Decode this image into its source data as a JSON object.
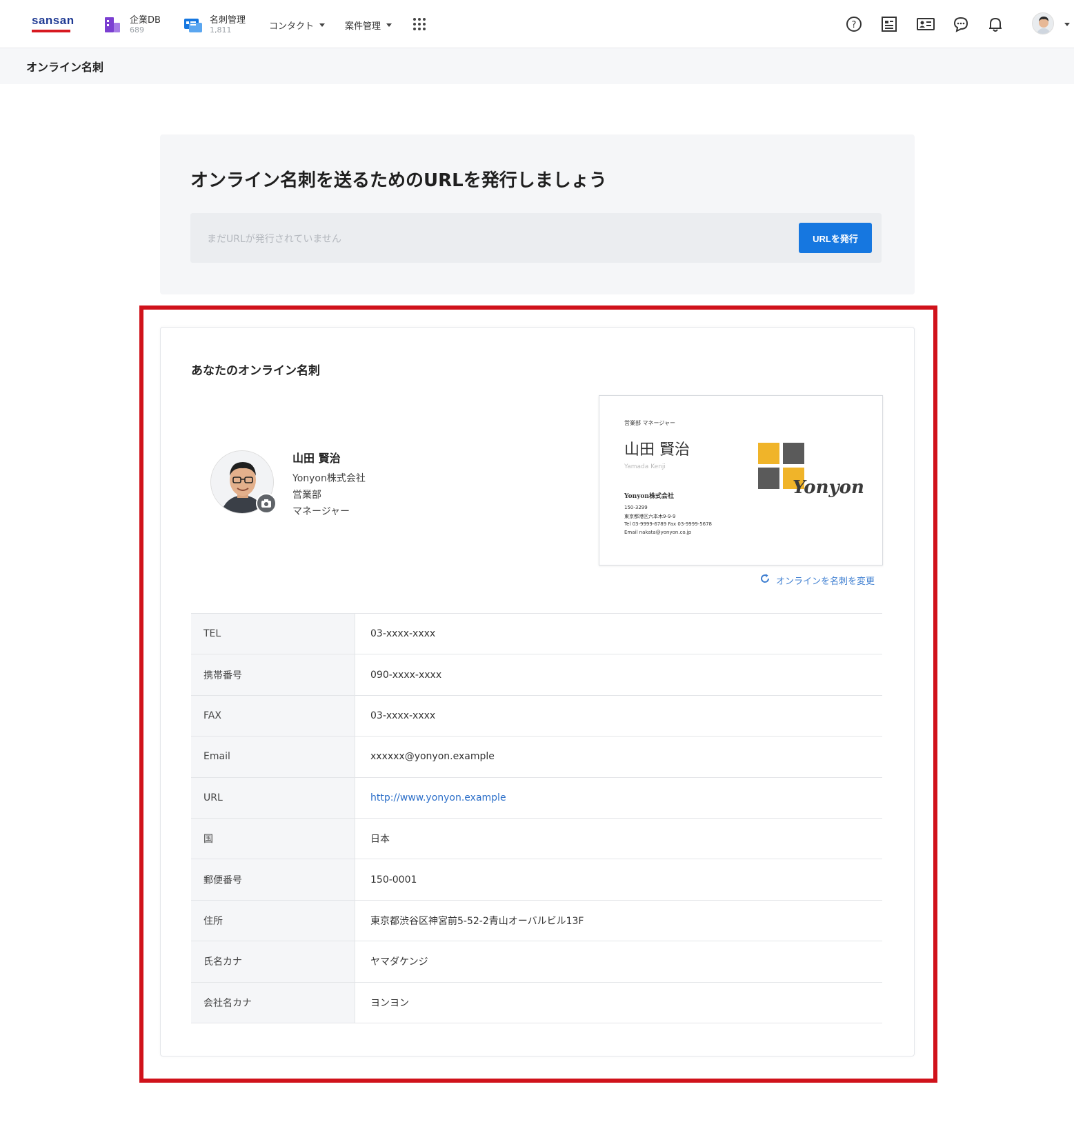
{
  "nav": {
    "logo": "sansan",
    "apps": [
      {
        "label": "企業DB",
        "count": "689"
      },
      {
        "label": "名刺管理",
        "count": "1,811"
      }
    ],
    "menus": [
      "コンタクト",
      "案件管理"
    ]
  },
  "page": {
    "title": "オンライン名刺"
  },
  "url_panel": {
    "heading": "オンライン名刺を送るためのURLを発行しましょう",
    "placeholder": "まだURLが発行されていません",
    "issue_button": "URLを発行"
  },
  "card_panel": {
    "section_title": "あなたのオンライン名刺",
    "profile": {
      "name": "山田 賢治",
      "company": "Yonyon株式会社",
      "department": "営業部",
      "title": "マネージャー"
    },
    "business_card": {
      "role": "営業部 マネージャー",
      "name": "山田 賢治",
      "roman": "Yamada Kenji",
      "company": "Yonyon株式会社",
      "postal": "150-3299",
      "address": "東京都港区六本木9-9-9",
      "tel_fax": "Tel 03-9999-6789  Fax 03-9999-5678",
      "email": "Email nakata@yonyon.co.jp",
      "brand": "Yonyon"
    },
    "change_link": "オンラインを名刺を変更",
    "fields": [
      {
        "label": "TEL",
        "value": "03-xxxx-xxxx"
      },
      {
        "label": "携帯番号",
        "value": "090-xxxx-xxxx"
      },
      {
        "label": "FAX",
        "value": "03-xxxx-xxxx"
      },
      {
        "label": "Email",
        "value": "xxxxxx@yonyon.example"
      },
      {
        "label": "URL",
        "value": "http://www.yonyon.example"
      },
      {
        "label": "国",
        "value": "日本"
      },
      {
        "label": "郵便番号",
        "value": "150-0001"
      },
      {
        "label": "住所",
        "value": "東京都渋谷区神宮前5-52-2青山オーバルビル13F"
      },
      {
        "label": "氏名カナ",
        "value": "ヤマダケンジ"
      },
      {
        "label": "会社名カナ",
        "value": "ヨンヨン"
      }
    ]
  },
  "colors": {
    "brand_blue": "#1f3a93",
    "brand_red": "#d71920",
    "primary_button": "#1677e0",
    "highlight_border": "#d0121b",
    "link": "#2c6fc9",
    "logo_yellow": "#f0b429",
    "logo_gray": "#5a5a5a"
  },
  "icons": [
    "company-db-icon",
    "card-management-icon",
    "apps-grid-icon",
    "help-icon",
    "list-icon",
    "contact-card-icon",
    "chat-icon",
    "bell-icon",
    "camera-icon",
    "refresh-icon"
  ]
}
